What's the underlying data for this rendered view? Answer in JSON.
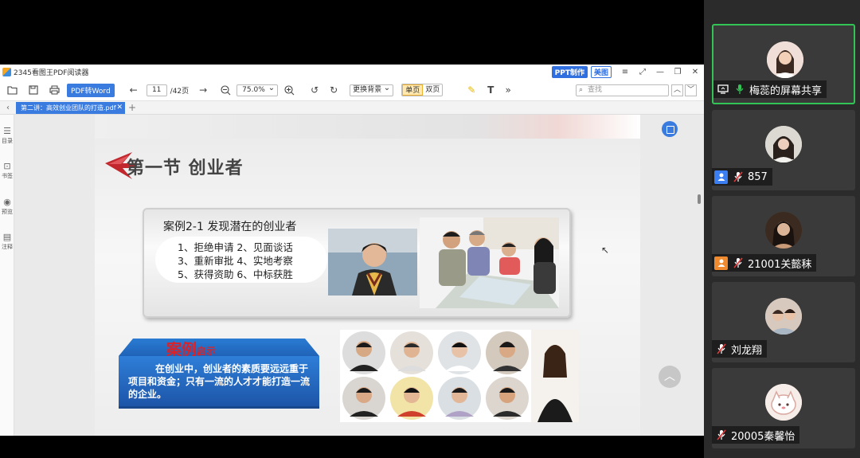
{
  "window": {
    "title": "2345看图王PDF阅读器",
    "ppt_button": "PPT制作",
    "beauty_button": "美图",
    "controls": [
      "≡",
      "—",
      "❐",
      "✕"
    ]
  },
  "toolbar": {
    "pdf_to_word": "PDF转Word",
    "current_page": "11",
    "total_pages": "/42页",
    "zoom": "75.0%",
    "background_select": "更换背景",
    "mode_single": "单页",
    "mode_double": "双页",
    "search_placeholder": "查找"
  },
  "tabs": [
    {
      "label": "第二讲：高效创业团队的打造.pdf"
    }
  ],
  "sidebar": {
    "items": [
      {
        "label": "目录",
        "icon": "toc-icon"
      },
      {
        "label": "书签",
        "icon": "bookmark-icon"
      },
      {
        "label": "预览",
        "icon": "eye-icon"
      },
      {
        "label": "注释",
        "icon": "comment-icon"
      }
    ]
  },
  "slide": {
    "section_title": "第一节 创业者",
    "case_title": "案例2-1  发现潜在的创业者",
    "case_lines": [
      "1、拒绝申请  2、见面谈话",
      "3、重新审批  4、实地考察",
      "5、获得资助  6、中标获胜"
    ],
    "insight_head": "案例",
    "insight_sub": "启示",
    "insight_text": "在创业中，创业者的素质要远远重于项目和资金；只有一流的人才才能打造一流的企业。"
  },
  "participants": [
    {
      "name": "梅蕊的屏幕共享",
      "badge": "screen",
      "active": true,
      "avatar_color": "#e8d0c8"
    },
    {
      "name": "857",
      "badge": "person-blue",
      "active": false,
      "avatar_color": "#d9d3cf"
    },
    {
      "name": "21001关懿秣",
      "badge": "person-orange",
      "active": false,
      "avatar_color": "#6b4a3a"
    },
    {
      "name": "刘龙翔",
      "badge": "none",
      "active": false,
      "avatar_color": "#c9b9ae"
    },
    {
      "name": "20005秦馨怡",
      "badge": "none",
      "active": false,
      "avatar_color": "#f2e4e0"
    }
  ],
  "colors": {
    "accent_blue": "#3a7be0",
    "active_green": "#32c556",
    "insight_red": "#d8232a"
  }
}
